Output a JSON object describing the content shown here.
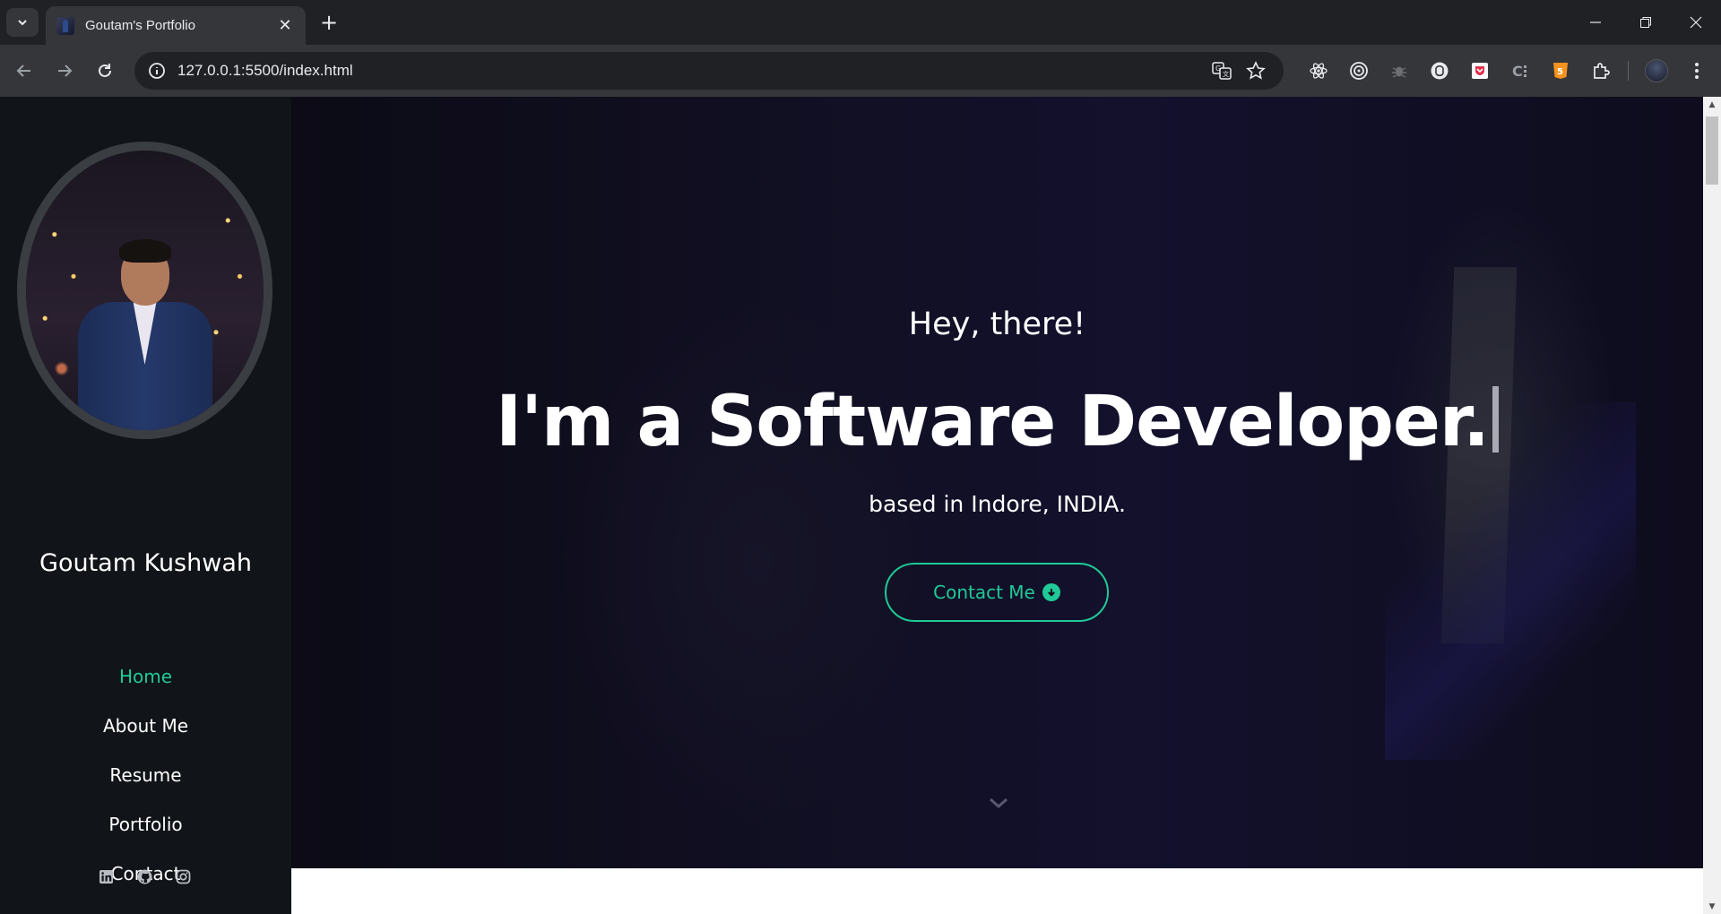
{
  "browser": {
    "tab_title": "Goutam's Portfolio",
    "url": "127.0.0.1:5500/index.html"
  },
  "sidebar": {
    "name": "Goutam Kushwah",
    "nav": [
      {
        "label": "Home",
        "active": true
      },
      {
        "label": "About Me",
        "active": false
      },
      {
        "label": "Resume",
        "active": false
      },
      {
        "label": "Portfolio",
        "active": false
      },
      {
        "label": "Contact",
        "active": false
      }
    ],
    "socials": [
      "linkedin-icon",
      "github-icon",
      "instagram-icon"
    ]
  },
  "hero": {
    "greeting": "Hey, there!",
    "headline": "I'm a Software Developer.",
    "location": "based in Indore, INDIA.",
    "cta_label": "Contact Me"
  },
  "colors": {
    "accent": "#20c997",
    "sidebar_bg": "#111418",
    "browser_frame": "#202124",
    "toolbar": "#35363a"
  }
}
